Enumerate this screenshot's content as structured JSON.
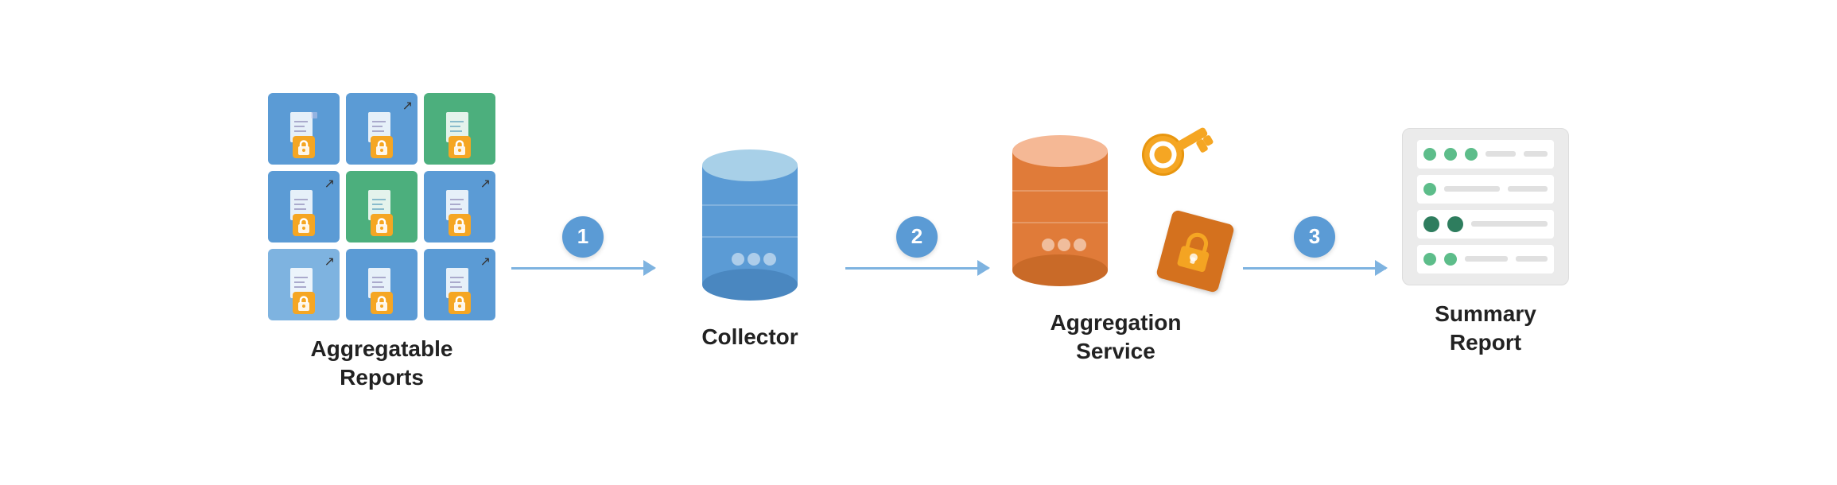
{
  "diagram": {
    "nodes": [
      {
        "id": "aggregatable-reports",
        "label_line1": "Aggregatable",
        "label_line2": "Reports"
      },
      {
        "id": "collector",
        "label_line1": "Collector",
        "label_line2": ""
      },
      {
        "id": "aggregation-service",
        "label_line1": "Aggregation",
        "label_line2": "Service"
      },
      {
        "id": "summary-report",
        "label_line1": "Summary",
        "label_line2": "Report"
      }
    ],
    "arrows": [
      {
        "step": "1"
      },
      {
        "step": "2"
      },
      {
        "step": "3"
      }
    ],
    "colors": {
      "blue": "#5B9BD5",
      "green": "#4CAF7D",
      "orange": "#E07B39",
      "gold": "#F5A623",
      "arrow": "#7EB3E0",
      "step_circle": "#5B9BD5"
    }
  }
}
